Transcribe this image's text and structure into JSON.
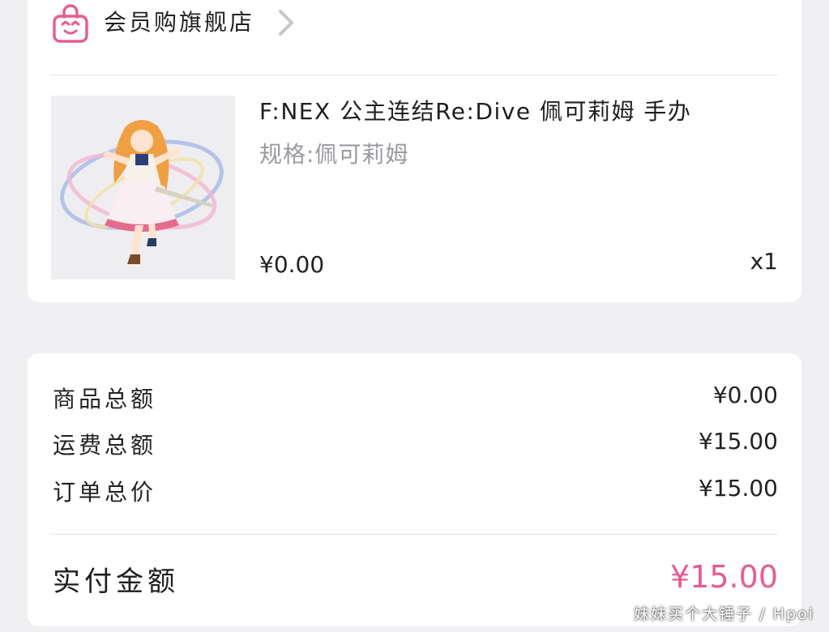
{
  "store": {
    "name": "会员购旗舰店",
    "icon": "shopping-bag-icon",
    "accent_color": "#e85a95"
  },
  "product": {
    "title": "F:NEX 公主连结Re:Dive 佩可莉姆 手办",
    "spec": "规格:佩可莉姆",
    "price": "¥0.00",
    "quantity": "x1"
  },
  "summary": {
    "goods_total_label": "商品总额",
    "goods_total_value": "¥0.00",
    "shipping_total_label": "运费总额",
    "shipping_total_value": "¥15.00",
    "order_total_label": "订单总价",
    "order_total_value": "¥15.00",
    "paid_label": "实付金额",
    "paid_value": "¥15.00",
    "paid_color": "#e85a95"
  },
  "watermark": "妹妹买个大锤子 / Hpoi"
}
